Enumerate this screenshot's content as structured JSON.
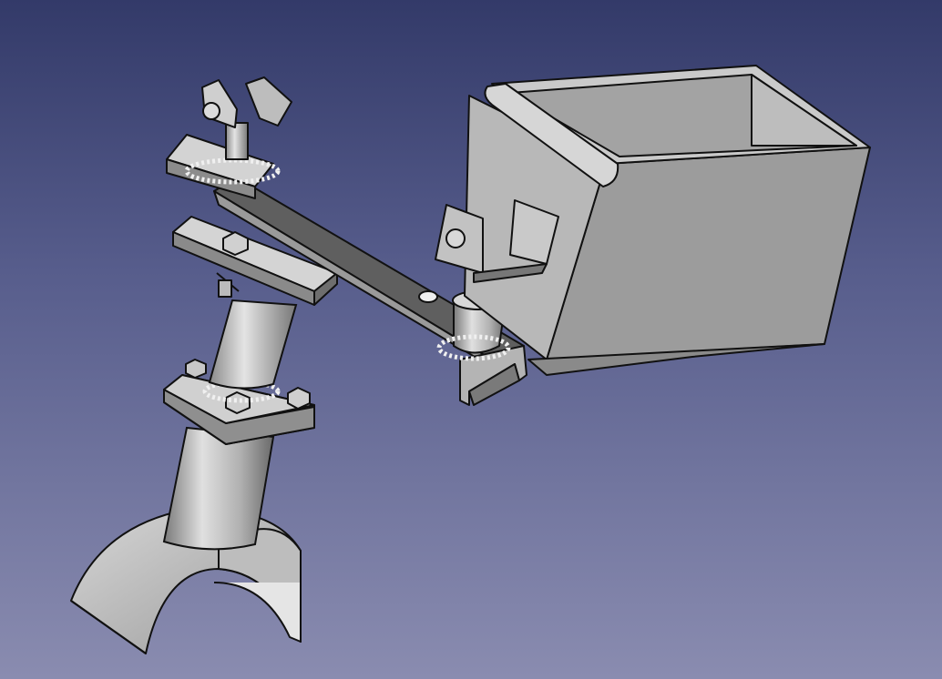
{
  "viewport": {
    "background_top": "#333a69",
    "background_bottom": "#8a8cb0"
  },
  "model": {
    "parts": [
      "pipe-clamp",
      "vertical-post",
      "flange-plate",
      "clamp-plates",
      "channel-arm",
      "top-bracket",
      "support-pin",
      "hinge-bracket",
      "box-container"
    ],
    "colors": {
      "light_face": "#cfcfcf",
      "mid_face": "#a8a8a8",
      "dark_face": "#6e6e6e",
      "edge": "#1a1a1a",
      "weld": "#e8e8e8"
    }
  }
}
